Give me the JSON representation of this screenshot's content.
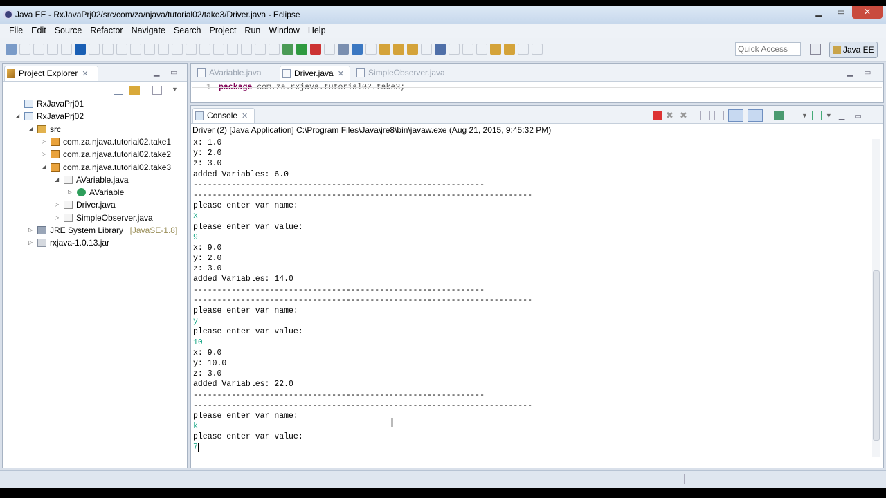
{
  "window": {
    "title": "Java EE - RxJavaPrj02/src/com/za/njava/tutorial02/take3/Driver.java - Eclipse"
  },
  "menu": [
    "File",
    "Edit",
    "Source",
    "Refactor",
    "Navigate",
    "Search",
    "Project",
    "Run",
    "Window",
    "Help"
  ],
  "toolbar": {
    "quick_access_placeholder": "Quick Access",
    "perspective": "Java EE"
  },
  "explorer": {
    "title": "Project Explorer",
    "items": [
      {
        "label": "RxJavaPrj01",
        "arrow": "",
        "indent": 0,
        "icon": "project-icon"
      },
      {
        "label": "RxJavaPrj02",
        "arrow": "◢",
        "indent": 0,
        "icon": "project-icon"
      },
      {
        "label": "src",
        "arrow": "◢",
        "indent": 1,
        "icon": "source-folder-icon"
      },
      {
        "label": "com.za.njava.tutorial02.take1",
        "arrow": "▷",
        "indent": 2,
        "icon": "package-icon"
      },
      {
        "label": "com.za.njava.tutorial02.take2",
        "arrow": "▷",
        "indent": 2,
        "icon": "package-icon"
      },
      {
        "label": "com.za.njava.tutorial02.take3",
        "arrow": "◢",
        "indent": 2,
        "icon": "package-icon"
      },
      {
        "label": "AVariable.java",
        "arrow": "◢",
        "indent": 3,
        "icon": "java-file-icon"
      },
      {
        "label": "AVariable",
        "arrow": "▷",
        "indent": 4,
        "icon": "class-icon"
      },
      {
        "label": "Driver.java",
        "arrow": "▷",
        "indent": 3,
        "icon": "java-file-icon"
      },
      {
        "label": "SimpleObserver.java",
        "arrow": "▷",
        "indent": 3,
        "icon": "java-file-icon"
      },
      {
        "label": "JRE System Library",
        "suffix": "[JavaSE-1.8]",
        "arrow": "▷",
        "indent": 1,
        "icon": "library-icon"
      },
      {
        "label": "rxjava-1.0.13.jar",
        "arrow": "▷",
        "indent": 1,
        "icon": "jar-icon"
      }
    ]
  },
  "editor": {
    "tabs": [
      {
        "label": "AVariable.java",
        "active": false
      },
      {
        "label": "Driver.java",
        "active": true
      },
      {
        "label": "SimpleObserver.java",
        "active": false
      }
    ],
    "line_number": "1",
    "code_line": "package com.za.rxjava.tutorial02.take3;"
  },
  "console": {
    "title": "Console",
    "launch": "Driver (2) [Java Application] C:\\Program Files\\Java\\jre8\\bin\\javaw.exe (Aug 21, 2015, 9:45:32 PM)",
    "lines": [
      {
        "text": "x: 1.0",
        "input": false
      },
      {
        "text": "y: 2.0",
        "input": false
      },
      {
        "text": "z: 3.0",
        "input": false
      },
      {
        "text": "added Variables: 6.0",
        "input": false
      },
      {
        "text": "-------------------------------------------------------------",
        "input": false
      },
      {
        "text": "-----------------------------------------------------------------------",
        "input": false
      },
      {
        "text": "please enter var name:",
        "input": false
      },
      {
        "text": "x",
        "input": true
      },
      {
        "text": "please enter var value:",
        "input": false
      },
      {
        "text": "9",
        "input": true
      },
      {
        "text": "x: 9.0",
        "input": false
      },
      {
        "text": "y: 2.0",
        "input": false
      },
      {
        "text": "z: 3.0",
        "input": false
      },
      {
        "text": "added Variables: 14.0",
        "input": false
      },
      {
        "text": "-------------------------------------------------------------",
        "input": false
      },
      {
        "text": "-----------------------------------------------------------------------",
        "input": false
      },
      {
        "text": "please enter var name:",
        "input": false
      },
      {
        "text": "y",
        "input": true
      },
      {
        "text": "please enter var value:",
        "input": false
      },
      {
        "text": "10",
        "input": true
      },
      {
        "text": "x: 9.0",
        "input": false
      },
      {
        "text": "y: 10.0",
        "input": false
      },
      {
        "text": "z: 3.0",
        "input": false
      },
      {
        "text": "added Variables: 22.0",
        "input": false
      },
      {
        "text": "-------------------------------------------------------------",
        "input": false
      },
      {
        "text": "-----------------------------------------------------------------------",
        "input": false
      },
      {
        "text": "please enter var name:",
        "input": false
      },
      {
        "text": "k",
        "input": true
      },
      {
        "text": "please enter var value:",
        "input": false
      },
      {
        "text": "7",
        "input": true
      }
    ]
  }
}
